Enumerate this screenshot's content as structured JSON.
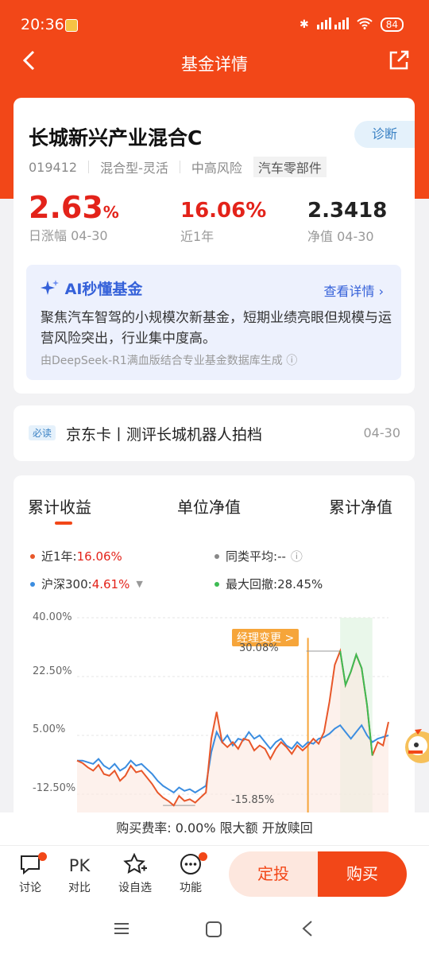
{
  "status": {
    "time": "20:36",
    "battery": "84"
  },
  "nav": {
    "title": "基金详情"
  },
  "fund": {
    "name": "长城新兴产业混合C",
    "diagnose": "诊断",
    "code": "019412",
    "type": "混合型-灵活",
    "risk": "中高风险",
    "industry": "汽车零部件",
    "daily_value": "2.63",
    "daily_unit": "%",
    "daily_label": "日涨幅 04-30",
    "year_value": "16.06%",
    "year_label": "近1年",
    "nav_value": "2.3418",
    "nav_label": "净值 04-30"
  },
  "ai": {
    "title": "AI秒懂基金",
    "more": "查看详情 ",
    "text": "聚焦汽车智驾的小规模次新基金，短期业绩亮眼但规模与运营风险突出，行业集中度高。",
    "source": "由DeepSeek-R1满血版结合专业基金数据库生成"
  },
  "news": {
    "badge": "必读",
    "title": "京东卡丨测评长城机器人拍档",
    "date": "04-30"
  },
  "chart_tabs": [
    "累计收益",
    "单位净值",
    "累计净值"
  ],
  "legend": {
    "fund_label": "近1年:",
    "fund_value": "16.06%",
    "peer_label": "同类平均:",
    "peer_value": "--",
    "index_label": "沪深300:",
    "index_value": "4.61%",
    "drawdown_label": "最大回撤:",
    "drawdown_value": "28.45%"
  },
  "chart_data": {
    "type": "line",
    "yticks": [
      "40.00%",
      "22.50%",
      "5.00%",
      "-12.50%"
    ],
    "ylim": [
      -20,
      40
    ],
    "annotations": {
      "manager_change": "经理变更 >",
      "max": "30.08%",
      "min": "-15.85%"
    },
    "series": [
      {
        "name": "近1年",
        "color": "#e8572a",
        "values": [
          -2.5,
          -3.2,
          -4.5,
          -5.5,
          -3.8,
          -6.5,
          -7,
          -5.5,
          -8.5,
          -7,
          -4,
          -6,
          -5.5,
          -7.5,
          -9.5,
          -12,
          -13.5,
          -14.5,
          -15.85,
          -13,
          -14.5,
          -14,
          -15,
          -13.5,
          -12,
          4,
          12,
          3,
          1.5,
          3,
          1,
          4,
          3.5,
          0.5,
          2,
          1,
          -2,
          1,
          3,
          1.5,
          -0.5,
          2,
          0.5,
          2,
          4,
          2.5,
          6,
          15,
          26,
          30.08,
          20,
          24,
          29,
          25,
          14,
          -1,
          3,
          2,
          9
        ]
      },
      {
        "name": "沪深300",
        "color": "#3b8de0",
        "values": [
          -2.5,
          -2.5,
          -3,
          -3.5,
          -2,
          -4,
          -5,
          -3.5,
          -5.5,
          -4.5,
          -2.5,
          -4,
          -3.5,
          -5,
          -6.5,
          -8.5,
          -10,
          -11,
          -12,
          -10.5,
          -11.5,
          -11,
          -12,
          -11,
          -10,
          0,
          6,
          3,
          5,
          2,
          4,
          3.5,
          6,
          4,
          5,
          3,
          1,
          3,
          4,
          2,
          1,
          3,
          1.5,
          3,
          2.5,
          4,
          4.5,
          5.5,
          7,
          8,
          6,
          4,
          6,
          8,
          5,
          3,
          4,
          4.5,
          5
        ]
      }
    ]
  },
  "fee": "购买费率: 0.00% 限大额 开放赎回",
  "actions": [
    "讨论",
    "对比",
    "设自选",
    "功能"
  ],
  "pk": "PK",
  "buttons": {
    "auto": "定投",
    "buy": "购买"
  }
}
